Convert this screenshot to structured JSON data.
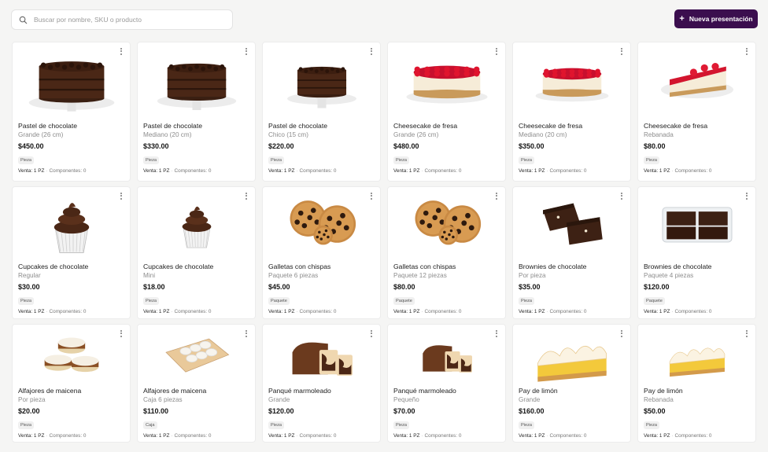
{
  "search": {
    "placeholder": "Buscar por nombre, SKU o producto",
    "value": ""
  },
  "toolbar": {
    "new_label": "Nueva presentación",
    "accent": "#3b0e4e"
  },
  "products": [
    {
      "name": "Pastel de chocolate",
      "variant": "Grande (26 cm)",
      "price": "$450.00",
      "unit": "Pieza",
      "sale": "Venta: 1 PZ",
      "components": "Componentes: 0",
      "image": "chocolate-cake-large"
    },
    {
      "name": "Pastel de chocolate",
      "variant": "Mediano (20 cm)",
      "price": "$330.00",
      "unit": "Pieza",
      "sale": "Venta: 1 PZ",
      "components": "Componentes: 0",
      "image": "chocolate-cake-medium"
    },
    {
      "name": "Pastel de chocolate",
      "variant": "Chico (15 cm)",
      "price": "$220.00",
      "unit": "Pieza",
      "sale": "Venta: 1 PZ",
      "components": "Componentes: 0",
      "image": "chocolate-cake-small"
    },
    {
      "name": "Cheesecake de fresa",
      "variant": "Grande (26 cm)",
      "price": "$480.00",
      "unit": "Pieza",
      "sale": "Venta: 1 PZ",
      "components": "Componentes: 0",
      "image": "strawberry-cheesecake-large"
    },
    {
      "name": "Cheesecake de fresa",
      "variant": "Mediano (20 cm)",
      "price": "$350.00",
      "unit": "Pieza",
      "sale": "Venta: 1 PZ",
      "components": "Componentes: 0",
      "image": "strawberry-cheesecake-medium"
    },
    {
      "name": "Cheesecake de fresa",
      "variant": "Rebanada",
      "price": "$80.00",
      "unit": "Pieza",
      "sale": "Venta: 1 PZ",
      "components": "Componentes: 0",
      "image": "strawberry-cheesecake-slice"
    },
    {
      "name": "Cupcakes de chocolate",
      "variant": "Regular",
      "price": "$30.00",
      "unit": "Pieza",
      "sale": "Venta: 1 PZ",
      "components": "Componentes: 0",
      "image": "chocolate-cupcake-regular"
    },
    {
      "name": "Cupcakes de chocolate",
      "variant": "Mini",
      "price": "$18.00",
      "unit": "Pieza",
      "sale": "Venta: 1 PZ",
      "components": "Componentes: 0",
      "image": "chocolate-cupcake-mini"
    },
    {
      "name": "Galletas con chispas",
      "variant": "Paquete 6 piezas",
      "price": "$45.00",
      "unit": "Paquete",
      "sale": "Venta: 1 PZ",
      "components": "Componentes: 0",
      "image": "chocolate-chip-cookies"
    },
    {
      "name": "Galletas con chispas",
      "variant": "Paquete 12 piezas",
      "price": "$80.00",
      "unit": "Paquete",
      "sale": "Venta: 1 PZ",
      "components": "Componentes: 0",
      "image": "chocolate-chip-cookies"
    },
    {
      "name": "Brownies de chocolate",
      "variant": "Por pieza",
      "price": "$35.00",
      "unit": "Pieza",
      "sale": "Venta: 1 PZ",
      "components": "Componentes: 0",
      "image": "brownies"
    },
    {
      "name": "Brownies de chocolate",
      "variant": "Paquete 4 piezas",
      "price": "$120.00",
      "unit": "Paquete",
      "sale": "Venta: 1 PZ",
      "components": "Componentes: 0",
      "image": "brownies-box"
    },
    {
      "name": "Alfajores de maicena",
      "variant": "Por pieza",
      "price": "$20.00",
      "unit": "Pieza",
      "sale": "Venta: 1 PZ",
      "components": "Componentes: 0",
      "image": "alfajores"
    },
    {
      "name": "Alfajores de maicena",
      "variant": "Caja 6 piezas",
      "price": "$110.00",
      "unit": "Caja",
      "sale": "Venta: 1 PZ",
      "components": "Componentes: 0",
      "image": "alfajores-box"
    },
    {
      "name": "Panqué marmoleado",
      "variant": "Grande",
      "price": "$120.00",
      "unit": "Pieza",
      "sale": "Venta: 1 PZ",
      "components": "Componentes: 0",
      "image": "marble-loaf-large"
    },
    {
      "name": "Panqué marmoleado",
      "variant": "Pequeño",
      "price": "$70.00",
      "unit": "Pieza",
      "sale": "Venta: 1 PZ",
      "components": "Componentes: 0",
      "image": "marble-loaf-small"
    },
    {
      "name": "Pay de limón",
      "variant": "Grande",
      "price": "$160.00",
      "unit": "Pieza",
      "sale": "Venta: 1 PZ",
      "components": "Componentes: 0",
      "image": "lemon-pie-large"
    },
    {
      "name": "Pay de limón",
      "variant": "Rebanada",
      "price": "$50.00",
      "unit": "Pieza",
      "sale": "Venta: 1 PZ",
      "components": "Componentes: 0",
      "image": "lemon-pie-slice"
    }
  ]
}
